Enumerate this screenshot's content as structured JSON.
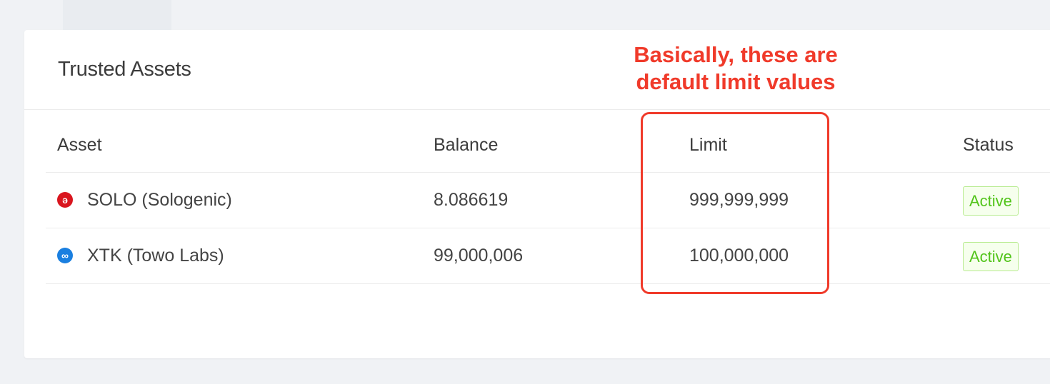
{
  "card": {
    "title": "Trusted Assets"
  },
  "table": {
    "columns": [
      "Asset",
      "Balance",
      "Limit",
      "Status"
    ],
    "rows": [
      {
        "asset": "SOLO (Sologenic)",
        "icon": "sologenic-icon",
        "icon_glyph": "ə",
        "icon_color": "#d9151e",
        "balance": "8.086619",
        "limit": "999,999,999",
        "status": "Active"
      },
      {
        "asset": "XTK (Towo Labs)",
        "icon": "towo-labs-icon",
        "icon_glyph": "∞",
        "icon_color": "#1a7fe0",
        "balance": "99,000,006",
        "limit": "100,000,000",
        "status": "Active"
      }
    ]
  },
  "annotation": {
    "line1": "Basically, these are",
    "line2": "default limit values",
    "color": "#f03a2a"
  },
  "colors": {
    "status_active": "#52c41a",
    "background": "#f0f2f5"
  }
}
